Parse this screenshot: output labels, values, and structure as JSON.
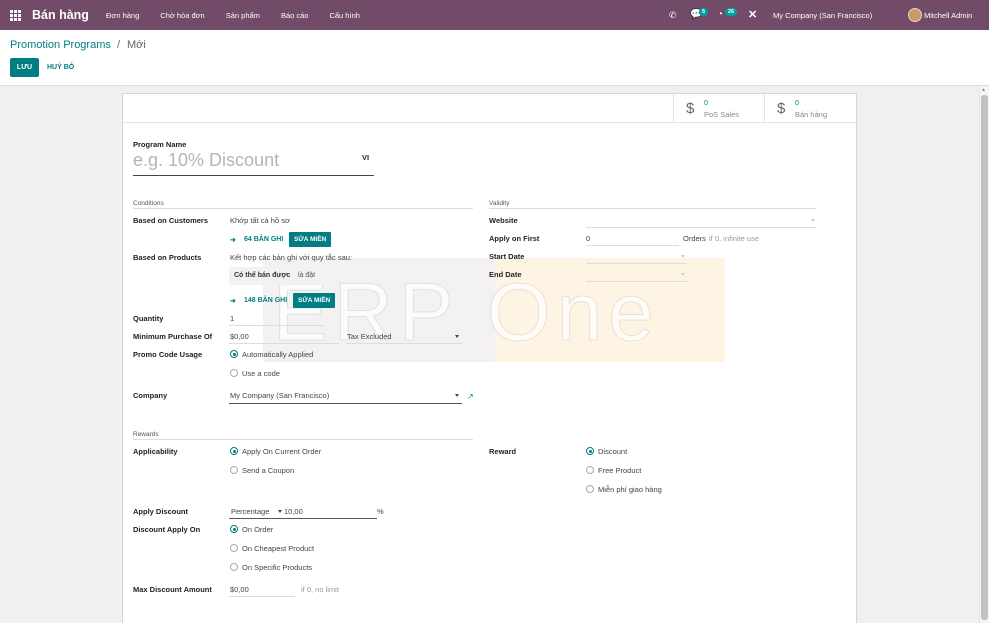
{
  "navbar": {
    "app_name": "Bán hàng",
    "menu": [
      "Đơn hàng",
      "Chờ hóa đơn",
      "Sản phẩm",
      "Báo cáo",
      "Cấu hình"
    ],
    "chat_count": "5",
    "activity_count": "26",
    "company": "My Company (San Francisco)",
    "user": "Mitchell Admin",
    "colors": {
      "navbar": "#714b67",
      "accent": "#017e84"
    },
    "icons": [
      "apps-grid-icon",
      "phone-icon",
      "chat-icon",
      "activity-clock-icon",
      "close-icon"
    ]
  },
  "breadcrumb": {
    "parent": "Promotion Programs",
    "separator": "/",
    "current": "Mới"
  },
  "actions": {
    "save": "LƯU",
    "discard": "HUỶ BỎ"
  },
  "smart_buttons": [
    {
      "count": "0",
      "label": "PoS Sales",
      "icon": "dollar-icon"
    },
    {
      "count": "0",
      "label": "Bán hàng",
      "icon": "dollar-icon"
    }
  ],
  "form": {
    "program_name_label": "Program Name",
    "program_name_placeholder": "e.g. 10% Discount",
    "lang": "VI",
    "conditions": {
      "title": "Conditions",
      "based_on_customers_label": "Based on Customers",
      "based_on_customers_value": "Khớp tất cả hồ sơ",
      "customers_records": "64 BẢN GHI",
      "edit_domain": "SỬA MIỀN",
      "based_on_products_label": "Based on Products",
      "based_on_products_value": "Kết hợp các bản ghi với quy tắc sau:",
      "rule_field": "Có thể bán được",
      "rule_op": "là đặt",
      "products_records": "148 BẢN GHI",
      "quantity_label": "Quantity",
      "quantity_value": "1",
      "min_purchase_label": "Minimum Purchase Of",
      "min_purchase_value": "$0,00",
      "tax_mode": "Tax Excluded",
      "promo_code_usage_label": "Promo Code Usage",
      "promo_options": [
        "Automatically Applied",
        "Use a code"
      ],
      "promo_selected": "Automatically Applied",
      "company_label": "Company",
      "company_value": "My Company (San Francisco)"
    },
    "validity": {
      "title": "Validity",
      "website_label": "Website",
      "website_value": "",
      "apply_on_first_label": "Apply on First",
      "apply_on_first_value": "0",
      "orders_label": "Orders",
      "orders_hint": "if 0, infinite use",
      "start_date_label": "Start Date",
      "end_date_label": "End Date"
    },
    "rewards": {
      "title": "Rewards",
      "applicability_label": "Applicability",
      "applicability_options": [
        "Apply On Current Order",
        "Send a Coupon"
      ],
      "applicability_selected": "Apply On Current Order",
      "reward_label": "Reward",
      "reward_options": [
        "Discount",
        "Free Product",
        "Miễn phí giao hàng"
      ],
      "reward_selected": "Discount",
      "apply_discount_label": "Apply Discount",
      "discount_type": "Percentage",
      "discount_value": "10,00",
      "discount_unit": "%",
      "discount_apply_on_label": "Discount Apply On",
      "apply_on_options": [
        "On Order",
        "On Cheapest Product",
        "On Specific Products"
      ],
      "apply_on_selected": "On Order",
      "max_discount_label": "Max Discount Amount",
      "max_discount_value": "$0,00",
      "max_discount_hint": "if 0, no limit"
    }
  },
  "watermark": "ERP One"
}
